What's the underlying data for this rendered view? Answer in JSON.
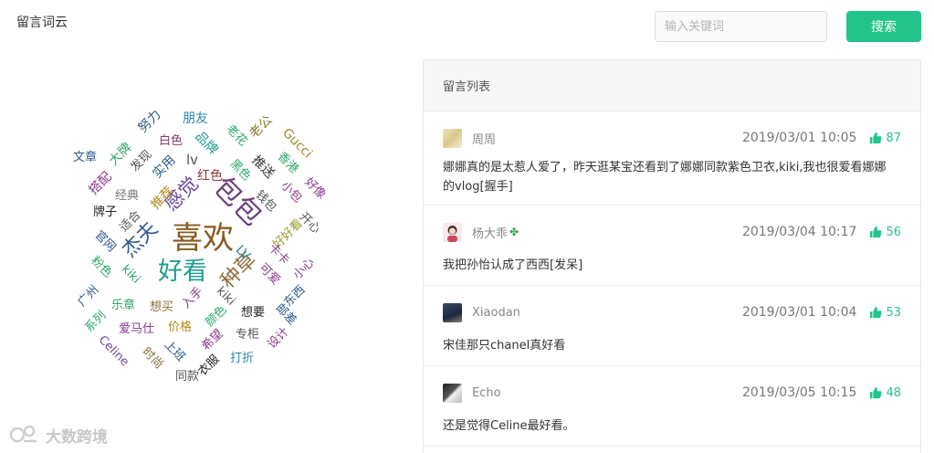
{
  "left_title": "留言词云",
  "search": {
    "placeholder": "输入关键词",
    "button_label": "搜索"
  },
  "panel": {
    "title": "留言列表"
  },
  "comments": [
    {
      "user": "周周",
      "time": "2019/03/01 10:05",
      "likes": "87",
      "text": "娜娜真的是太惹人爱了，昨天逛某宝还看到了娜娜同款紫色卫衣,kiki,我也很爱看娜娜的vlog[握手]"
    },
    {
      "user": "杨大乖",
      "time": "2019/03/04 10:17",
      "likes": "56",
      "text": "我把孙怡认成了西西[发呆]"
    },
    {
      "user": "Xiaodan",
      "time": "2019/03/01 10:04",
      "likes": "53",
      "text": "宋佳那只chanel真好看"
    },
    {
      "user": "Echo",
      "time": "2019/03/05 10:15",
      "likes": "48",
      "text": "还是觉得Celine最好看。"
    }
  ],
  "word_cloud": [
    {
      "text": "喜欢",
      "color": "#8a5a1e"
    },
    {
      "text": "包包",
      "color": "#6b3c7a"
    },
    {
      "text": "好看",
      "color": "#1f9d8f"
    },
    {
      "text": "杰夫",
      "color": "#2e5a8c"
    },
    {
      "text": "感觉",
      "color": "#6a4a9a"
    },
    {
      "text": "种草",
      "color": "#8a6d3b"
    },
    {
      "text": "朋友",
      "color": "#2e86a8"
    },
    {
      "text": "努力",
      "color": "#2e5a8c"
    },
    {
      "text": "老公",
      "color": "#8a7a2a"
    },
    {
      "text": "Gucci",
      "color": "#9a8a2a"
    },
    {
      "text": "文章",
      "color": "#2e5a8c"
    },
    {
      "text": "大牌",
      "color": "#2fa76a"
    },
    {
      "text": "发现",
      "color": "#555555"
    },
    {
      "text": "白色",
      "color": "#8a3a6a"
    },
    {
      "text": "品牌",
      "color": "#1f9d8f"
    },
    {
      "text": "老花",
      "color": "#2fa76a"
    },
    {
      "text": "香港",
      "color": "#2fa76a"
    },
    {
      "text": "搭配",
      "color": "#8a3a8a"
    },
    {
      "text": "实用",
      "color": "#2e5a8c"
    },
    {
      "text": "lv",
      "color": "#555555"
    },
    {
      "text": "红色",
      "color": "#8a3a3a"
    },
    {
      "text": "黑色",
      "color": "#2fa76a"
    },
    {
      "text": "推送",
      "color": "#333333"
    },
    {
      "text": "小包",
      "color": "#8a3a8a"
    },
    {
      "text": "好像",
      "color": "#8a3a8a"
    },
    {
      "text": "经典",
      "color": "#777777"
    },
    {
      "text": "推荐",
      "color": "#b08a1a"
    },
    {
      "text": "钱包",
      "color": "#555555"
    },
    {
      "text": "牌子",
      "color": "#222222"
    },
    {
      "text": "适合",
      "color": "#555555"
    },
    {
      "text": "开心",
      "color": "#555555"
    },
    {
      "text": "官网",
      "color": "#2e5a8c"
    },
    {
      "text": "好好看",
      "color": "#9a9a2a"
    },
    {
      "text": "LV",
      "color": "#2e86a8"
    },
    {
      "text": "卡卡",
      "color": "#8a3a8a"
    },
    {
      "text": "粉色",
      "color": "#2fa76a"
    },
    {
      "text": "kiki",
      "color": "#2fa76a"
    },
    {
      "text": "可爱",
      "color": "#8a3a8a"
    },
    {
      "text": "小心",
      "color": "#8a3a8a"
    },
    {
      "text": "广州",
      "color": "#2e5a8c"
    },
    {
      "text": "乐章",
      "color": "#2fa76a"
    },
    {
      "text": "想买",
      "color": "#8a6d3b"
    },
    {
      "text": "入手",
      "color": "#8a3a8a"
    },
    {
      "text": "kiki",
      "color": "#555555"
    },
    {
      "text": "想要",
      "color": "#222222"
    },
    {
      "text": "东西",
      "color": "#2e5a8c"
    },
    {
      "text": "系列",
      "color": "#2fa76a"
    },
    {
      "text": "爱马仕",
      "color": "#8a3a8a"
    },
    {
      "text": "价格",
      "color": "#b08a1a"
    },
    {
      "text": "颜色",
      "color": "#2fa76a"
    },
    {
      "text": "邮差",
      "color": "#2e5a8c"
    },
    {
      "text": "Celine",
      "color": "#6a4a9a"
    },
    {
      "text": "上班",
      "color": "#2e5a8c"
    },
    {
      "text": "希望",
      "color": "#8a3a8a"
    },
    {
      "text": "专柜",
      "color": "#555555"
    },
    {
      "text": "设计",
      "color": "#8a3a8a"
    },
    {
      "text": "时尚",
      "color": "#8a6d3b"
    },
    {
      "text": "衣服",
      "color": "#222222"
    },
    {
      "text": "打折",
      "color": "#2e86a8"
    },
    {
      "text": "同款",
      "color": "#555555"
    }
  ],
  "watermark": {
    "text": "大数跨境"
  }
}
